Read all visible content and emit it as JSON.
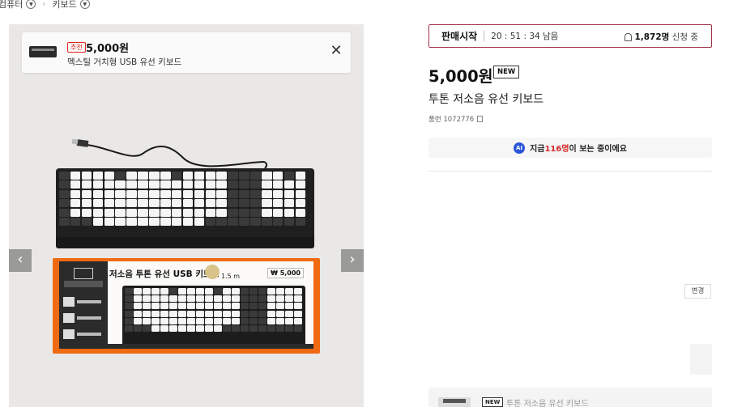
{
  "breadcrumb": {
    "items": [
      {
        "label": "컴퓨터"
      },
      {
        "label": "키보드"
      }
    ]
  },
  "recommend": {
    "badge": "추천",
    "price": "5,000원",
    "name": "멕스틸 거치형 USB 유선 키보드",
    "close": "✕"
  },
  "gallery": {
    "prev": "‹",
    "next": "›",
    "box_title": "저소음 투톤 유선 USB 키보드",
    "box_length": "1.5 m",
    "box_price": "₩ 5,000"
  },
  "timer": {
    "label": "판매시작",
    "remain": "20 : 51 : 34 남음",
    "applicants": "1,872명",
    "apply_suffix": "신청 중"
  },
  "product": {
    "price": "5,000원",
    "badge": "NEW",
    "name": "투톤 저소음 유선 키보드",
    "code": "품번 1072776"
  },
  "viewers": {
    "ai": "AI",
    "prefix": "지금 ",
    "count": "116명",
    "suffix": "이 보는 중이에요"
  },
  "option": {
    "change": "변경"
  },
  "bottom_bar": {
    "badge": "NEW",
    "name": "투톤 저소음 유선 키보드"
  }
}
